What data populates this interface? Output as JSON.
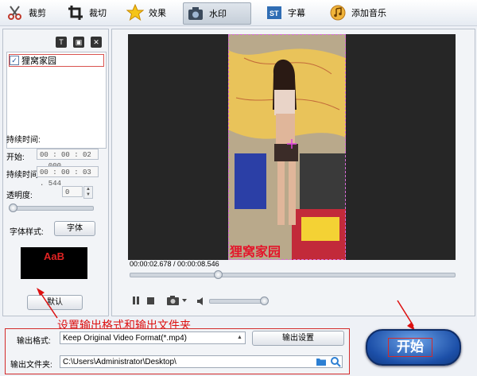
{
  "toolbar": {
    "items": [
      {
        "label": "裁剪",
        "icon": "scissors-icon"
      },
      {
        "label": "裁切",
        "icon": "crop-icon"
      },
      {
        "label": "效果",
        "icon": "star-effect-icon"
      },
      {
        "label": "水印",
        "icon": "watermark-icon"
      },
      {
        "label": "字幕",
        "icon": "subtitle-icon"
      },
      {
        "label": "添加音乐",
        "icon": "music-icon"
      }
    ]
  },
  "watermark": {
    "list": [
      {
        "label": "狸窝家园",
        "checked": true
      }
    ],
    "duration_label": "持续时间:",
    "start_label": "开始:",
    "start_value": "00 : 00 : 02 . 000",
    "duration_field_label": "持续时间",
    "duration_value": "00 : 00 : 03 . 544",
    "opacity_label": "透明度:",
    "opacity_value": "0",
    "font_style_label": "字体样式:",
    "font_button": "字体",
    "preview_text": "AaB",
    "default_button": "默认"
  },
  "video": {
    "watermark_overlay": "狸窝家园",
    "time": "00:00:02.678 / 00:00:08.546",
    "progress": 0.27,
    "volume": 1.0
  },
  "output": {
    "annotation": "设置输出格式和输出文件夹",
    "format_label": "输出格式:",
    "format_value": "Keep Original Video Format(*.mp4)",
    "settings_button": "输出设置",
    "folder_label": "输出文件夹:",
    "folder_value": "C:\\Users\\Administrator\\Desktop\\"
  },
  "start_button": "开始",
  "colors": {
    "accent": "#1c4fa8",
    "highlight": "#d32a2a"
  }
}
